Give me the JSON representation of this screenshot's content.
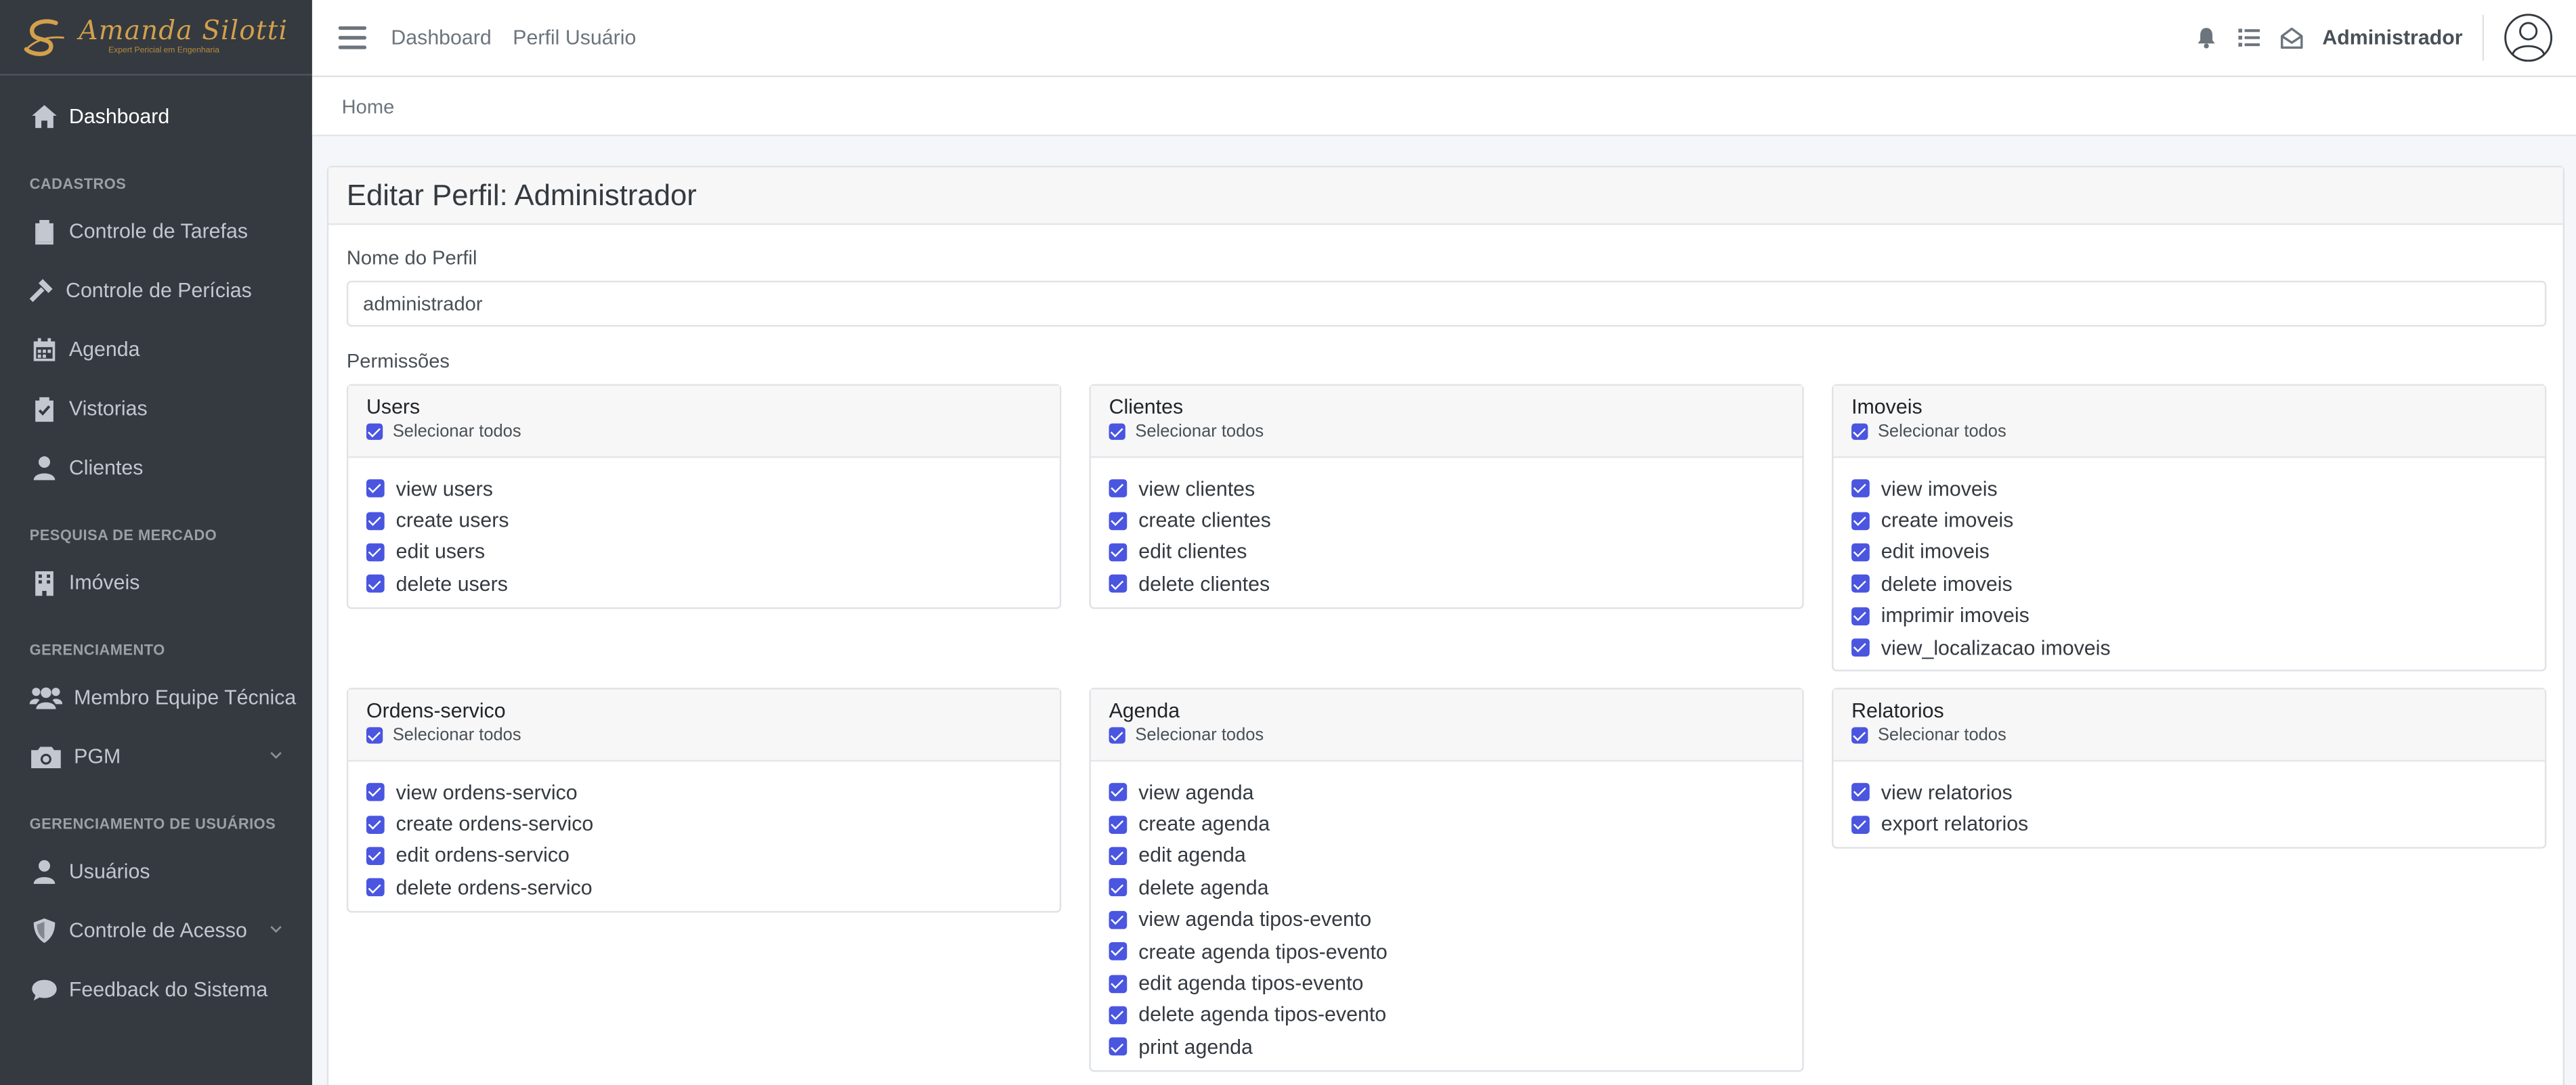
{
  "brand": {
    "name": "Amanda  Silotti",
    "subtitle": "Expert Pericial em Engenharia"
  },
  "sidebar": {
    "dashboard": "Dashboard",
    "sections": [
      {
        "header": "CADASTROS",
        "items": [
          "Controle de Tarefas",
          "Controle de Perícias",
          "Agenda",
          "Vistorias",
          "Clientes"
        ]
      },
      {
        "header": "PESQUISA DE MERCADO",
        "items": [
          "Imóveis"
        ]
      },
      {
        "header": "GERENCIAMENTO",
        "items": [
          "Membro Equipe Técnica",
          "PGM"
        ]
      },
      {
        "header": "GERENCIAMENTO DE USUÁRIOS",
        "items": [
          "Usuários",
          "Controle de Acesso",
          "Feedback do Sistema"
        ]
      }
    ]
  },
  "topbar": {
    "links": [
      "Dashboard",
      "Perfil Usuário"
    ],
    "user": "Administrador"
  },
  "breadcrumb": "Home",
  "card": {
    "title": "Editar Perfil: Administrador",
    "name_label": "Nome do Perfil",
    "name_value": "administrador",
    "perms_label": "Permissões"
  },
  "select_all_label": "Selecionar todos",
  "permissions": [
    {
      "title": "Users",
      "items": [
        "view users",
        "create users",
        "edit users",
        "delete users"
      ]
    },
    {
      "title": "Clientes",
      "items": [
        "view clientes",
        "create clientes",
        "edit clientes",
        "delete clientes"
      ]
    },
    {
      "title": "Imoveis",
      "items": [
        "view imoveis",
        "create imoveis",
        "edit imoveis",
        "delete imoveis",
        "imprimir imoveis",
        "view_localizacao imoveis"
      ]
    },
    {
      "title": "Ordens-servico",
      "items": [
        "view ordens-servico",
        "create ordens-servico",
        "edit ordens-servico",
        "delete ordens-servico"
      ]
    },
    {
      "title": "Agenda",
      "items": [
        "view agenda",
        "create agenda",
        "edit agenda",
        "delete agenda",
        "view agenda tipos-evento",
        "create agenda tipos-evento",
        "edit agenda tipos-evento",
        "delete agenda tipos-evento",
        "print agenda"
      ]
    },
    {
      "title": "Relatorios",
      "items": [
        "view relatorios",
        "export relatorios"
      ]
    }
  ],
  "colors": {
    "sidebar": "#343a40",
    "checkbox": "#4a55e0",
    "brand": "#d4a04c"
  }
}
